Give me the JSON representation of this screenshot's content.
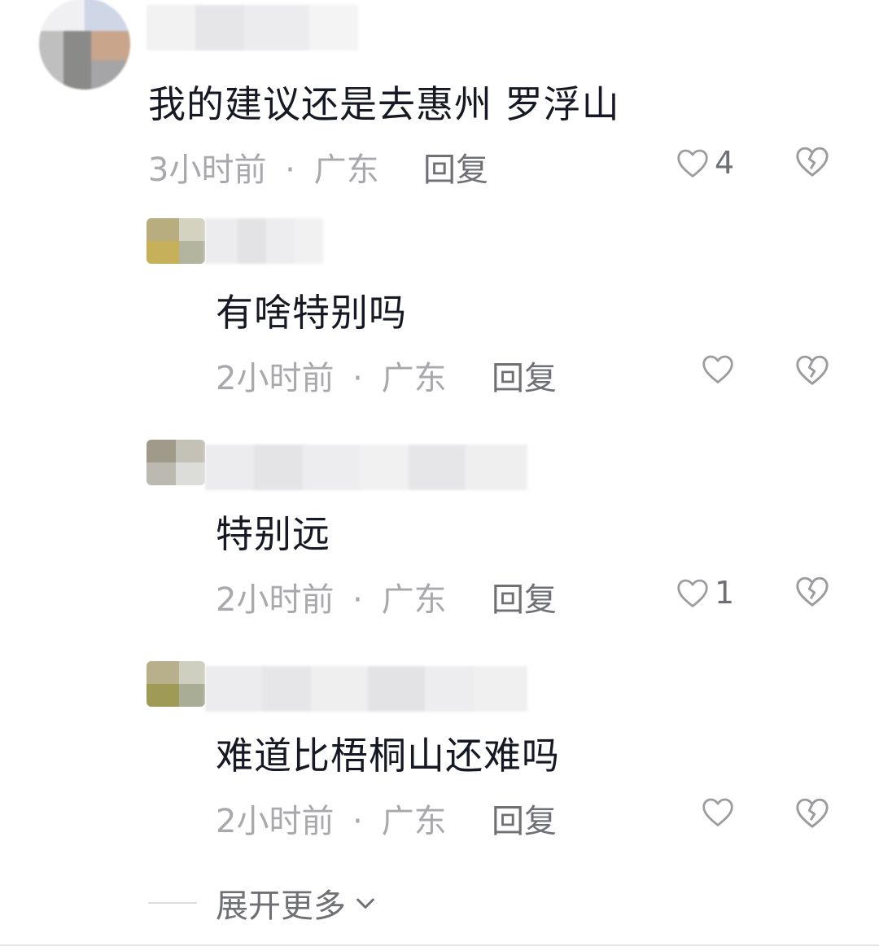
{
  "comments": [
    {
      "text": "我的建议还是去惠州 罗浮山",
      "time": "3小时前",
      "dot": "·",
      "location": "广东",
      "reply_label": "回复",
      "likes": "4"
    }
  ],
  "replies": [
    {
      "text": "有啥特别吗",
      "time": "2小时前",
      "dot": "·",
      "location": "广东",
      "reply_label": "回复",
      "likes": ""
    },
    {
      "text": "特别远",
      "time": "2小时前",
      "dot": "·",
      "location": "广东",
      "reply_label": "回复",
      "likes": "1"
    },
    {
      "text": "难道比梧桐山还难吗",
      "time": "2小时前",
      "dot": "·",
      "location": "广东",
      "reply_label": "回复",
      "likes": ""
    }
  ],
  "expand_label": "展开更多",
  "icons": {
    "like": "heart-outline-icon",
    "dislike": "broken-heart-icon",
    "expand": "chevron-down-icon"
  },
  "colors": {
    "text_primary": "#161823",
    "text_meta": "#a9a9ad",
    "text_secondary": "#6f7075",
    "icon": "#9b9ca0"
  }
}
